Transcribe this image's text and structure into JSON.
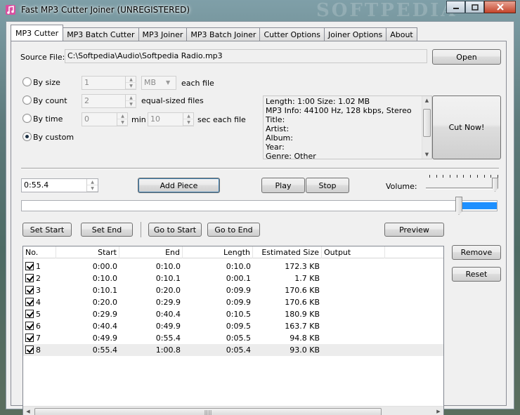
{
  "window": {
    "title": "Fast MP3 Cutter Joiner (UNREGISTERED)",
    "watermark": "SOFTPEDIA"
  },
  "tabs": [
    {
      "label": "MP3 Cutter",
      "active": true
    },
    {
      "label": "MP3 Batch Cutter"
    },
    {
      "label": "MP3 Joiner"
    },
    {
      "label": "MP3 Batch Joiner"
    },
    {
      "label": "Cutter Options"
    },
    {
      "label": "Joiner Options"
    },
    {
      "label": "About"
    }
  ],
  "source": {
    "label": "Source File:",
    "path": "C:\\Softpedia\\Audio\\Softpedia Radio.mp3",
    "open_label": "Open"
  },
  "split": {
    "by_size": {
      "label": "By size",
      "value": "1",
      "unit": "MB",
      "suffix": "each file"
    },
    "by_count": {
      "label": "By count",
      "value": "2",
      "suffix": "equal-sized files"
    },
    "by_time": {
      "label": "By time",
      "min_value": "0",
      "min_label": "min",
      "sec_value": "10",
      "suffix": "sec each file"
    },
    "by_custom": {
      "label": "By custom",
      "checked": true
    }
  },
  "info": {
    "lines": [
      "Length: 1:00     Size: 1.02 MB",
      "MP3 Info: 44100 Hz, 128 kbps, Stereo",
      "Title:",
      "Artist:",
      "Album:",
      "Year:",
      "Genre: Other"
    ]
  },
  "cut_now_label": "Cut Now!",
  "controls": {
    "time_value": "0:55.4",
    "add_piece": "Add Piece",
    "play": "Play",
    "stop": "Stop",
    "volume_label": "Volume:",
    "volume_level": 1.0,
    "position_fraction": 0.92
  },
  "actions": {
    "set_start": "Set Start",
    "set_end": "Set End",
    "go_to_start": "Go to Start",
    "go_to_end": "Go to End",
    "preview": "Preview",
    "remove": "Remove",
    "reset": "Reset"
  },
  "table": {
    "columns": [
      "No.",
      "Start",
      "End",
      "Length",
      "Estimated Size",
      "Output"
    ],
    "rows": [
      {
        "no": "1",
        "start": "0:00.0",
        "end": "0:10.0",
        "length": "0:10.0",
        "size": "172.3 KB",
        "output": "",
        "checked": true
      },
      {
        "no": "2",
        "start": "0:10.0",
        "end": "0:10.1",
        "length": "0:00.1",
        "size": "1.7 KB",
        "output": "",
        "checked": true
      },
      {
        "no": "3",
        "start": "0:10.1",
        "end": "0:20.0",
        "length": "0:09.9",
        "size": "170.6 KB",
        "output": "",
        "checked": true
      },
      {
        "no": "4",
        "start": "0:20.0",
        "end": "0:29.9",
        "length": "0:09.9",
        "size": "170.6 KB",
        "output": "",
        "checked": true
      },
      {
        "no": "5",
        "start": "0:29.9",
        "end": "0:40.4",
        "length": "0:10.5",
        "size": "180.9 KB",
        "output": "",
        "checked": true
      },
      {
        "no": "6",
        "start": "0:40.4",
        "end": "0:49.9",
        "length": "0:09.5",
        "size": "163.7 KB",
        "output": "",
        "checked": true
      },
      {
        "no": "7",
        "start": "0:49.9",
        "end": "0:55.4",
        "length": "0:05.5",
        "size": "94.8 KB",
        "output": "",
        "checked": true
      },
      {
        "no": "8",
        "start": "0:55.4",
        "end": "1:00.8",
        "length": "0:05.4",
        "size": "93.0 KB",
        "output": "",
        "checked": true,
        "selected": true
      }
    ]
  },
  "colors": {
    "progress_fill": "#1e90ff",
    "selected_row": "#ececec"
  }
}
